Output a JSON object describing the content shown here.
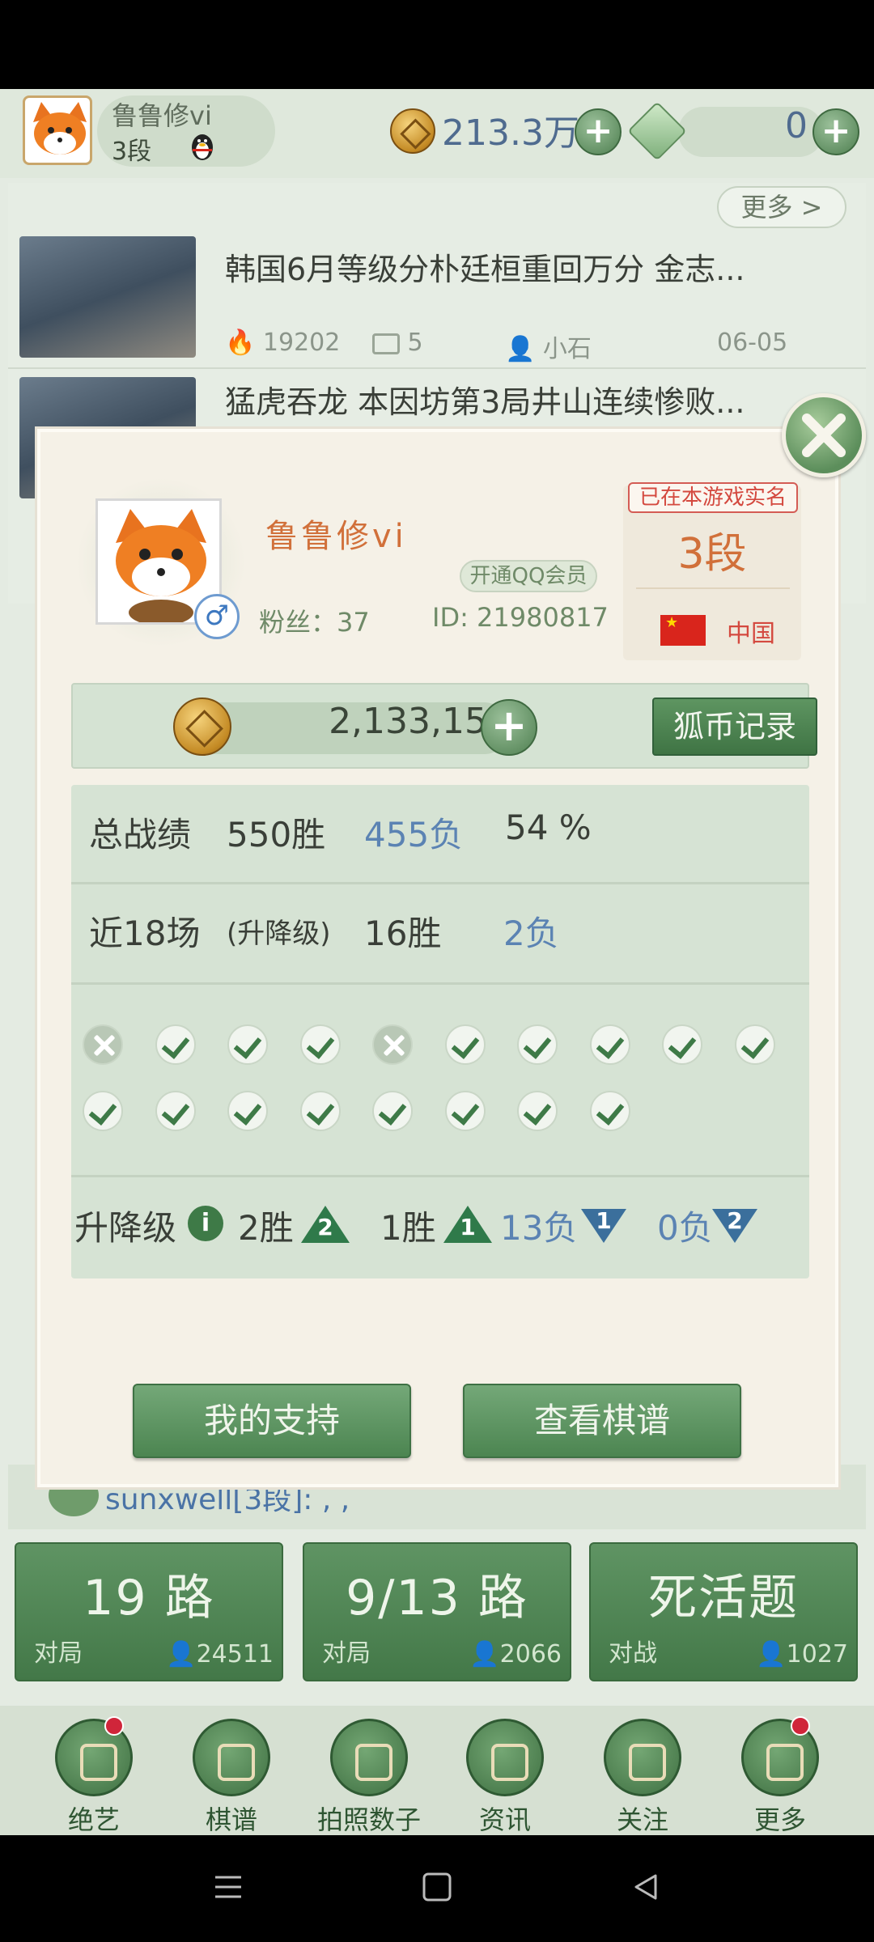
{
  "topbar": {
    "username": "鲁鲁修vi",
    "rank": "3段",
    "coins": "213.3万",
    "gems": "0"
  },
  "news": {
    "more_label": "更多 >",
    "items": [
      {
        "title": "韩国6月等级分朴廷桓重回万分 金志...",
        "views": "19202",
        "comments": "5",
        "author": "小石",
        "date": "06-05"
      },
      {
        "title": "猛虎吞龙 本因坊第3局井山连续惨败..."
      }
    ]
  },
  "chat": {
    "message": "sunxwell[3段]: , ,"
  },
  "modes": [
    {
      "title": "19 路",
      "sub": "对局",
      "count": "24511"
    },
    {
      "title": "9/13 路",
      "sub": "对局",
      "count": "2066"
    },
    {
      "title": "死活题",
      "sub": "对战",
      "count": "1027"
    }
  ],
  "bottom_nav": [
    {
      "label": "绝艺",
      "icon": "jueyi-icon",
      "badge": true
    },
    {
      "label": "棋谱",
      "icon": "kifu-icon",
      "badge": false
    },
    {
      "label": "拍照数子",
      "icon": "camera-icon",
      "badge": false
    },
    {
      "label": "资讯",
      "icon": "news-icon",
      "badge": false
    },
    {
      "label": "关注",
      "icon": "follow-icon",
      "badge": false
    },
    {
      "label": "更多",
      "icon": "more-icon",
      "badge": true
    }
  ],
  "profile": {
    "name": "鲁鲁修vi",
    "fans_label": "粉丝：37",
    "id_label": "ID: 21980817",
    "qq_vip": "开通QQ会员",
    "realname_badge": "已在本游戏实名",
    "rank": "3段",
    "country": "中国",
    "coin_value": "2,133,159",
    "coin_record": "狐币记录"
  },
  "stats": {
    "total_label": "总战绩",
    "total_wins": "550胜",
    "total_losses": "455负",
    "win_rate": "54 %",
    "recent_label": "近18场",
    "recent_type": "(升降级)",
    "recent_wins": "16胜",
    "recent_losses": "2负",
    "recent_results": [
      "L",
      "W",
      "W",
      "W",
      "L",
      "W",
      "W",
      "W",
      "W",
      "W",
      "W",
      "W",
      "W",
      "W",
      "W",
      "W",
      "W",
      "W"
    ],
    "promo_label": "升降级",
    "promo": [
      {
        "text": "2胜",
        "dir": "up",
        "num": "2"
      },
      {
        "text": "1胜",
        "dir": "up",
        "num": "1"
      },
      {
        "text": "13负",
        "dir": "down",
        "num": "1"
      },
      {
        "text": "0负",
        "dir": "down",
        "num": "2"
      }
    ]
  },
  "buttons": {
    "support": "我的支持",
    "kifu": "查看棋谱"
  },
  "colors": {
    "accent_green": "#4c8551",
    "name_orange": "#d1703a",
    "loss_blue": "#5b83b3",
    "badge_red": "#d4493f"
  }
}
